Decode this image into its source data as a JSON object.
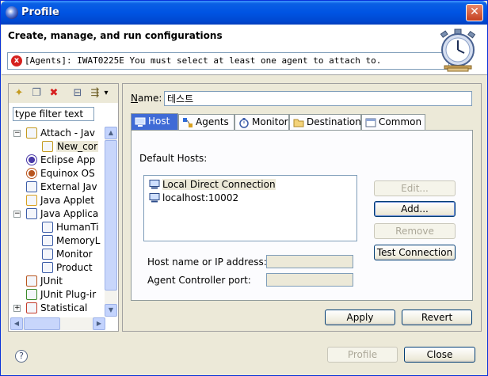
{
  "window": {
    "title": "Profile",
    "close_glyph": "✕"
  },
  "banner": {
    "title": "Create, manage, and run configurations",
    "error_message": "[Agents]: IWAT0225E You must select at least one agent to attach to.",
    "error_glyph": "x"
  },
  "left": {
    "toolbar": [
      {
        "name": "new-launch-config-icon",
        "glyph": "✦"
      },
      {
        "name": "duplicate-config-icon",
        "glyph": "❐"
      },
      {
        "name": "delete-config-icon",
        "glyph": "✖",
        "color": "#d62020"
      },
      {
        "name": "collapse-all-icon",
        "glyph": "⊟"
      },
      {
        "name": "filter-icon",
        "glyph": "⇶"
      },
      {
        "name": "filter-menu-chevron-icon",
        "glyph": "▾"
      }
    ],
    "filter_value": "type filter text",
    "tree": [
      {
        "label": "Attach - Jav",
        "toggle": "−",
        "depth": 0,
        "icon": "attach-icon"
      },
      {
        "label": "New_cor",
        "toggle": "",
        "depth": 1,
        "icon": "attach-config-icon",
        "selected": true
      },
      {
        "label": "Eclipse App",
        "toggle": "",
        "depth": 0,
        "icon": "eclipse-app-icon"
      },
      {
        "label": "Equinox OS",
        "toggle": "",
        "depth": 0,
        "icon": "equinox-icon"
      },
      {
        "label": "External Jav",
        "toggle": "",
        "depth": 0,
        "icon": "external-java-icon"
      },
      {
        "label": "Java Applet",
        "toggle": "",
        "depth": 0,
        "icon": "java-applet-icon"
      },
      {
        "label": "Java Applica",
        "toggle": "−",
        "depth": 0,
        "icon": "java-app-icon"
      },
      {
        "label": "HumanTi",
        "toggle": "",
        "depth": 1,
        "icon": "java-config-icon"
      },
      {
        "label": "MemoryL",
        "toggle": "",
        "depth": 1,
        "icon": "java-config-icon"
      },
      {
        "label": "Monitor",
        "toggle": "",
        "depth": 1,
        "icon": "java-config-icon"
      },
      {
        "label": "Product",
        "toggle": "",
        "depth": 1,
        "icon": "java-config-icon"
      },
      {
        "label": "JUnit",
        "toggle": "",
        "depth": 0,
        "icon": "junit-icon"
      },
      {
        "label": "JUnit Plug-ir",
        "toggle": "",
        "depth": 0,
        "icon": "junit-plugin-icon"
      },
      {
        "label": "Statistical",
        "toggle": "+",
        "depth": 0,
        "icon": "statistical-icon"
      }
    ]
  },
  "right": {
    "name_label_prefix": "N",
    "name_label_rest": "ame:",
    "name_value": "테스트",
    "tabs": [
      {
        "label": "Host",
        "active": true,
        "icon": "host-icon"
      },
      {
        "label": "Agents",
        "active": false,
        "icon": "agents-icon"
      },
      {
        "label": "Monitor",
        "active": false,
        "icon": "monitor-icon"
      },
      {
        "label": "Destination",
        "active": false,
        "icon": "folder-icon"
      },
      {
        "label": "Common",
        "active": false,
        "icon": "common-icon"
      }
    ],
    "hosts_label": "Default Hosts:",
    "hosts": [
      {
        "label": "Local Direct Connection",
        "selected": true
      },
      {
        "label": "localhost:10002",
        "selected": false
      }
    ],
    "buttons": {
      "edit": "Edit...",
      "add": "Add...",
      "remove": "Remove",
      "test": "Test Connection"
    },
    "host_name_label": "Host name or IP address:",
    "agent_port_label": "Agent Controller port:",
    "host_name_value": "",
    "agent_port_value": "",
    "apply": "Apply",
    "revert": "Revert"
  },
  "footer": {
    "help_glyph": "?",
    "profile": "Profile",
    "close": "Close"
  }
}
